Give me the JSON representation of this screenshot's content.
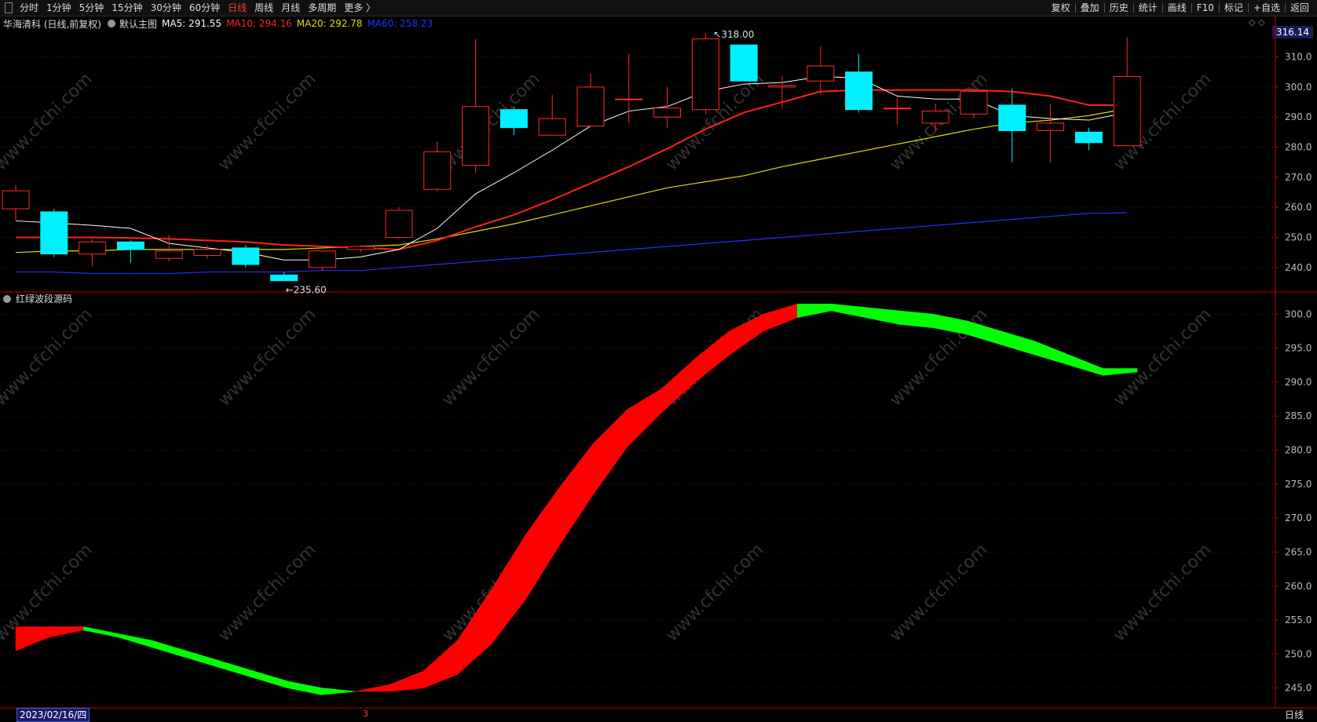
{
  "toolbar": {
    "periods": [
      "分时",
      "1分钟",
      "5分钟",
      "15分钟",
      "30分钟",
      "60分钟",
      "日线",
      "周线",
      "月线",
      "多周期",
      "更多 〉"
    ],
    "active_period": "日线",
    "tools": [
      "复权",
      "叠加",
      "历史",
      "统计",
      "画线",
      "F10",
      "标记",
      "+自选",
      "返回"
    ]
  },
  "info": {
    "stock": "华海清科 (日线,前复权)",
    "template": "默认主图",
    "ma5": "MA5: 291.55",
    "ma10": "MA10: 294.16",
    "ma20": "MA20: 292.78",
    "ma60": "MA60: 258.23"
  },
  "price_tag": "316.14",
  "high_label": "318.00",
  "low_label": "235.60",
  "indicator_title": "红绿波段源码",
  "date_label": "2023/02/16/四",
  "period_label": "日线",
  "marker": "3",
  "watermark": "www.cfchi.com",
  "colors": {
    "up": "#ff2a2a",
    "down": "#00f0ff",
    "ma5": "#ffffff",
    "ma10": "#ff2020",
    "ma20": "#e0e000",
    "ma60": "#2030ff",
    "band_up": "#ff0000",
    "band_down": "#00ff00",
    "grid": "#7a0000"
  },
  "chart_data": [
    {
      "type": "candlestick",
      "y_ticks": [
        240,
        250,
        260,
        270,
        280,
        290,
        300,
        310
      ],
      "ylim": [
        235,
        318.5
      ],
      "candles": [
        {
          "o": 259.5,
          "c": 265.5,
          "h": 267.5,
          "l": 255.5
        },
        {
          "o": 258.5,
          "c": 244.5,
          "h": 259.5,
          "l": 243.5
        },
        {
          "o": 244.5,
          "c": 248.5,
          "h": 249.5,
          "l": 240.5
        },
        {
          "o": 248.5,
          "c": 246.0,
          "h": 249.0,
          "l": 241.5
        },
        {
          "o": 243.0,
          "c": 245.5,
          "h": 251.0,
          "l": 242.0
        },
        {
          "o": 244.0,
          "c": 246.0,
          "h": 247.5,
          "l": 243.0
        },
        {
          "o": 246.5,
          "c": 241.0,
          "h": 247.5,
          "l": 240.0
        },
        {
          "o": 237.5,
          "c": 235.6,
          "h": 238.5,
          "l": 235.6
        },
        {
          "o": 240.0,
          "c": 245.5,
          "h": 245.5,
          "l": 239.0
        },
        {
          "o": 246.0,
          "c": 247.0,
          "h": 247.5,
          "l": 245.0
        },
        {
          "o": 250.0,
          "c": 259.0,
          "h": 260.0,
          "l": 249.5
        },
        {
          "o": 266.0,
          "c": 278.5,
          "h": 282.0,
          "l": 265.5
        },
        {
          "o": 274.0,
          "c": 293.5,
          "h": 316.0,
          "l": 271.5
        },
        {
          "o": 292.5,
          "c": 286.5,
          "h": 293.5,
          "l": 284.0
        },
        {
          "o": 284.0,
          "c": 289.5,
          "h": 297.5,
          "l": 283.5
        },
        {
          "o": 287.0,
          "c": 300.0,
          "h": 304.5,
          "l": 287.0
        },
        {
          "o": 296.0,
          "c": 296.0,
          "h": 311.0,
          "l": 288.0
        },
        {
          "o": 290.0,
          "c": 293.0,
          "h": 300.0,
          "l": 286.5
        },
        {
          "o": 292.5,
          "c": 316.0,
          "h": 318.0,
          "l": 291.0
        },
        {
          "o": 314.0,
          "c": 302.0,
          "h": 314.0,
          "l": 302.0
        },
        {
          "o": 300.0,
          "c": 300.5,
          "h": 303.5,
          "l": 293.0
        },
        {
          "o": 302.0,
          "c": 307.0,
          "h": 313.5,
          "l": 297.5
        },
        {
          "o": 305.0,
          "c": 292.5,
          "h": 311.0,
          "l": 291.5
        },
        {
          "o": 293.0,
          "c": 293.0,
          "h": 296.5,
          "l": 287.5
        },
        {
          "o": 288.0,
          "c": 292.0,
          "h": 294.5,
          "l": 285.0
        },
        {
          "o": 291.0,
          "c": 298.5,
          "h": 299.5,
          "l": 289.5
        },
        {
          "o": 294.0,
          "c": 285.5,
          "h": 299.5,
          "l": 275.0
        },
        {
          "o": 285.5,
          "c": 288.0,
          "h": 294.5,
          "l": 275.0
        },
        {
          "o": 285.0,
          "c": 281.5,
          "h": 286.5,
          "l": 279.0
        },
        {
          "o": 280.5,
          "c": 303.5,
          "h": 316.5,
          "l": 280.5
        }
      ],
      "ma5": [
        255.5,
        254.8,
        254.0,
        253.0,
        248.0,
        246.5,
        245.0,
        242.5,
        242.5,
        243.5,
        246.0,
        253.0,
        264.5,
        271.5,
        279.0,
        287.0,
        292.0,
        293.5,
        298.5,
        301.0,
        301.5,
        303.5,
        303.0,
        297.0,
        296.0,
        296.0,
        290.5,
        289.5,
        289.0,
        291.5
      ],
      "ma10": [
        250.0,
        250.0,
        250.0,
        249.8,
        249.5,
        249.0,
        248.5,
        247.5,
        247.0,
        246.5,
        246.0,
        249.0,
        253.5,
        257.5,
        262.5,
        268.0,
        273.5,
        279.5,
        286.0,
        291.5,
        295.0,
        298.5,
        299.0,
        299.0,
        299.0,
        299.0,
        298.5,
        297.0,
        294.0,
        294.0
      ],
      "ma20": [
        245.0,
        245.5,
        245.5,
        246.0,
        246.0,
        246.0,
        246.0,
        246.0,
        246.5,
        247.0,
        247.5,
        249.5,
        252.0,
        254.5,
        257.5,
        260.5,
        263.5,
        266.5,
        268.5,
        270.5,
        273.5,
        276.0,
        278.5,
        281.0,
        283.5,
        286.0,
        288.0,
        289.0,
        290.5,
        292.8
      ],
      "ma60": [
        238.5,
        238.5,
        238.0,
        238.0,
        238.0,
        238.5,
        238.5,
        238.5,
        239.0,
        239.0,
        240.0,
        241.0,
        242.0,
        243.0,
        244.0,
        245.0,
        246.0,
        247.0,
        248.0,
        249.0,
        250.0,
        251.0,
        252.0,
        253.0,
        254.0,
        255.0,
        256.0,
        257.0,
        258.0,
        258.2
      ]
    },
    {
      "type": "area",
      "title": "红绿波段源码",
      "y_ticks": [
        245,
        250,
        255,
        260,
        265,
        270,
        275,
        280,
        285,
        290,
        295,
        300
      ],
      "ylim": [
        243,
        302
      ],
      "upper": [
        254.0,
        254.0,
        254.0,
        253.0,
        252.0,
        250.5,
        249.0,
        247.5,
        246.0,
        245.0,
        244.5,
        245.5,
        247.5,
        252.0,
        259.5,
        267.5,
        274.5,
        281.0,
        286.0,
        289.0,
        293.5,
        297.5,
        300.0,
        301.5,
        301.5,
        301.0,
        300.5,
        300.0,
        299.0,
        297.5,
        296.0,
        294.0,
        292.0,
        292.0
      ],
      "lower": [
        250.5,
        252.5,
        253.5,
        252.5,
        251.0,
        249.5,
        248.0,
        246.5,
        245.0,
        244.0,
        244.5,
        244.5,
        245.0,
        247.0,
        251.5,
        258.0,
        266.0,
        273.5,
        280.5,
        285.5,
        290.0,
        294.0,
        297.5,
        299.5,
        300.5,
        299.5,
        298.5,
        298.0,
        297.0,
        295.5,
        294.0,
        292.5,
        291.0,
        291.5
      ],
      "band_colors": [
        "up",
        "up",
        "down",
        "down",
        "down",
        "down",
        "down",
        "down",
        "down",
        "down",
        "up",
        "up",
        "up",
        "up",
        "up",
        "up",
        "up",
        "up",
        "up",
        "up",
        "up",
        "up",
        "up",
        "down",
        "down",
        "down",
        "down",
        "down",
        "down",
        "down",
        "down",
        "down",
        "down"
      ]
    }
  ]
}
